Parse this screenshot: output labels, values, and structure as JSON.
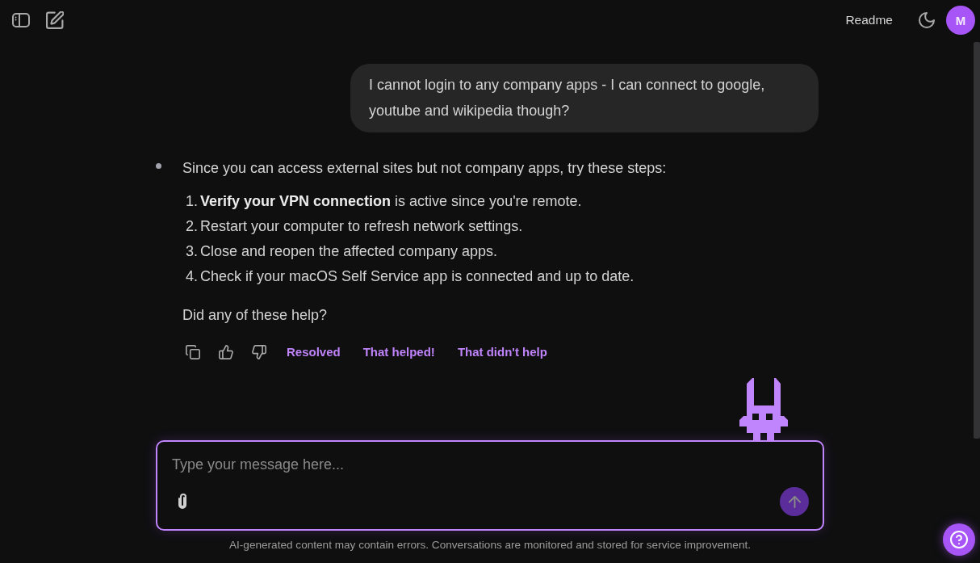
{
  "header": {
    "readme_link": "Readme",
    "avatar_initial": "M"
  },
  "messages": [
    {
      "kind": "user",
      "text": "I cannot login to any company apps - I can connect to google, youtube and wikipedia though?"
    },
    {
      "kind": "assistant",
      "intro": "Since you can access external sites but not company apps, try these steps:",
      "steps": [
        {
          "number": "1.",
          "text": "**Verify your VPN connection** is active since you're remote."
        },
        {
          "number": "2.",
          "text": "Restart your computer to refresh network settings."
        },
        {
          "number": "3.",
          "text": "Close and reopen the affected company apps."
        },
        {
          "number": "4.",
          "text": "Check if your macOS Self Service app is connected and up to date."
        }
      ],
      "closing": "Did any of these help?",
      "feedback_options": [
        "Resolved",
        "That helped!",
        "That didn't help"
      ]
    }
  ],
  "composer": {
    "placeholder": "Type your message here...",
    "send_button": {
      "disabled": true
    }
  },
  "disclaimer": "AI-generated content may contain errors. Conversations are monitored and stored for service improvement."
}
